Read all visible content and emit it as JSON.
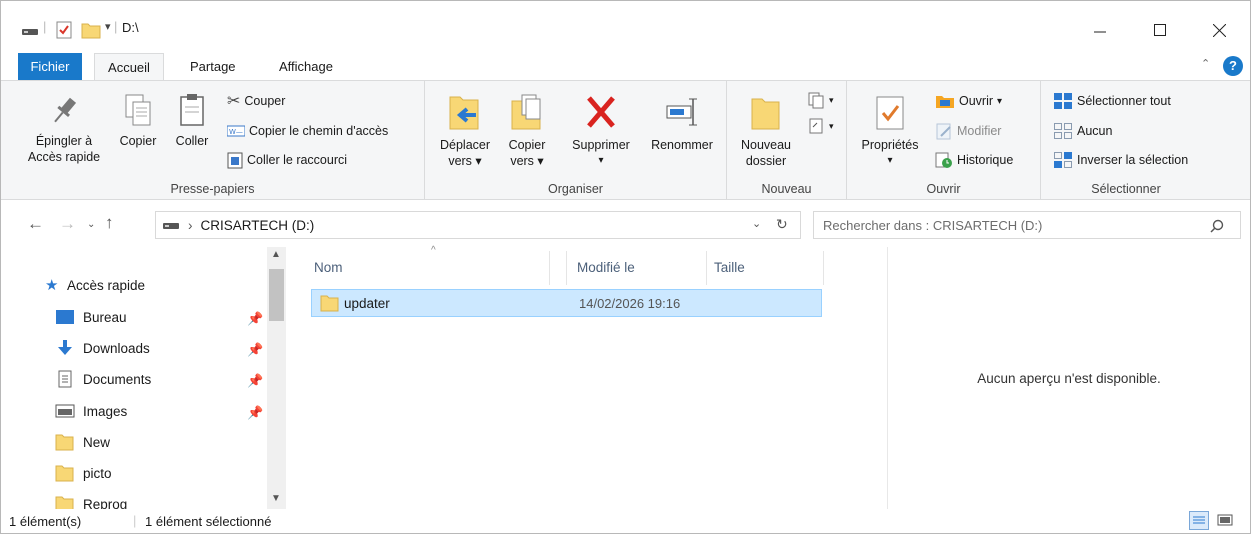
{
  "title": "D:\\",
  "tabs": {
    "file": "Fichier",
    "home": "Accueil",
    "share": "Partage",
    "view": "Affichage"
  },
  "help_glyph": "?",
  "ribbon": {
    "clipboard": {
      "label": "Presse-papiers",
      "pin_line1": "Épingler à",
      "pin_line2": "Accès rapide",
      "copy": "Copier",
      "paste": "Coller",
      "cut": "Couper",
      "copy_path": "Copier le chemin d'accès",
      "paste_shortcut": "Coller le raccourci"
    },
    "organize": {
      "label": "Organiser",
      "move_line1": "Déplacer",
      "move_line2": "vers",
      "copyto_line1": "Copier",
      "copyto_line2": "vers",
      "delete": "Supprimer",
      "rename": "Renommer"
    },
    "new": {
      "label": "Nouveau",
      "folder_line1": "Nouveau",
      "folder_line2": "dossier"
    },
    "open": {
      "label": "Ouvrir",
      "properties": "Propriétés",
      "open": "Ouvrir",
      "edit": "Modifier",
      "history": "Historique"
    },
    "select": {
      "label": "Sélectionner",
      "all": "Sélectionner tout",
      "none": "Aucun",
      "invert": "Inverser la sélection"
    }
  },
  "address": {
    "path": "CRISARTECH (D:)",
    "search_placeholder": "Rechercher dans : CRISARTECH (D:)"
  },
  "navpane": {
    "quick_access": "Accès rapide",
    "items": [
      {
        "label": "Bureau",
        "pinned": true
      },
      {
        "label": "Downloads",
        "pinned": true
      },
      {
        "label": "Documents",
        "pinned": true
      },
      {
        "label": "Images",
        "pinned": true
      },
      {
        "label": "New",
        "pinned": false
      },
      {
        "label": "picto",
        "pinned": false
      },
      {
        "label": "Reprog",
        "pinned": false
      }
    ]
  },
  "columns": {
    "name": "Nom",
    "modified": "Modifié le",
    "size": "Taille"
  },
  "files": [
    {
      "name": "updater",
      "modified": "14/02/2026 19:16",
      "size": "",
      "selected": true
    }
  ],
  "preview": "Aucun aperçu n'est disponible.",
  "status": {
    "count": "1 élément(s)",
    "selected": "1 élément sélectionné"
  },
  "colors": {
    "accent": "#1979ca",
    "selection": "#cce8ff",
    "folder": "#f8d775"
  }
}
